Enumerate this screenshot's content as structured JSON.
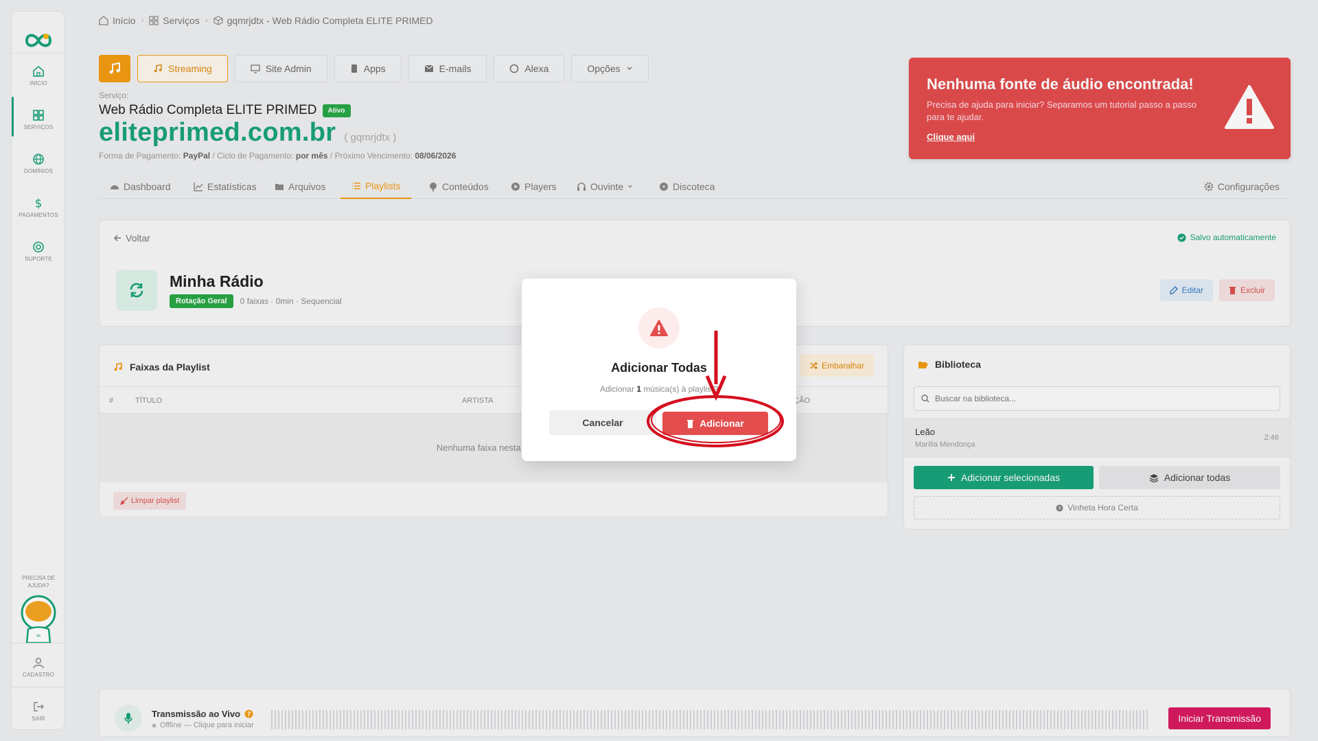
{
  "sidebar": {
    "items": [
      {
        "label": "INÍCIO",
        "icon": "home-icon"
      },
      {
        "label": "SERVIÇOS",
        "icon": "grid-icon"
      },
      {
        "label": "DOMÍNIOS",
        "icon": "globe-icon"
      },
      {
        "label": "PAGAMENTOS",
        "icon": "dollar-icon"
      },
      {
        "label": "SUPORTE",
        "icon": "lifebuoy-icon"
      }
    ],
    "help_line1": "PRECISA DE",
    "help_line2": "AJUDA?",
    "cadastro": "CADASTRO",
    "sair": "SAIR"
  },
  "breadcrumb": {
    "home": "Início",
    "services": "Serviços",
    "current": "gqmrjdtx - Web Rádio Completa ELITE PRIMED"
  },
  "top_tabs": [
    "Streaming",
    "Site Admin",
    "Apps",
    "E-mails",
    "Alexa",
    "Opções"
  ],
  "service": {
    "label": "Serviço:",
    "name": "Web Rádio Completa ELITE PRIMED",
    "status": "Ativo",
    "domain": "eliteprimed.com.br",
    "id": "( gqmrjdtx )",
    "payment_label": "Forma de Pagamento:",
    "payment_value": "PayPal",
    "cycle_label": "/ Ciclo de Pagamento:",
    "cycle_value": "por mês",
    "due_label": "/ Próximo Vencimento:",
    "due_value": "08/06/2026"
  },
  "alert": {
    "title": "Nenhuma fonte de áudio encontrada!",
    "text": "Precisa de ajuda para iniciar? Separamos um tutorial passo a passo para te ajudar.",
    "link": "Clique aqui",
    "color": "#e34d4d"
  },
  "nav_tabs": [
    "Dashboard",
    "Estatísticas",
    "Arquivos",
    "Playlists",
    "Conteúdos",
    "Players",
    "Ouvinte",
    "Discoteca",
    "Configurações"
  ],
  "playlist": {
    "back": "Voltar",
    "saved": "Salvo automaticamente",
    "title": "Minha Rádio",
    "badge": "Rotação Geral",
    "meta": "0 faixas · 0min · Sequencial",
    "edit": "Editar",
    "delete": "Excluir"
  },
  "tracks": {
    "title": "Faixas da Playlist",
    "shuffle": "Embaralhar",
    "col_num": "#",
    "col_title": "TÍTULO",
    "col_artist": "ARTISTA",
    "col_duration": "DURAÇÃO",
    "empty": "Nenhuma faixa nesta playlist",
    "clear": "Limpar playlist"
  },
  "library": {
    "title": "Biblioteca",
    "search_placeholder": "Buscar na biblioteca...",
    "song": "Leão",
    "artist": "Marília Mendonça",
    "duration": "2:46",
    "add_selected": "Adicionar selecionadas",
    "add_all": "Adicionar todas",
    "vinheta": "Vinheta Hora Certa"
  },
  "live": {
    "title": "Transmissão ao Vivo",
    "status": "Offline — Clique para iniciar",
    "button": "Iniciar Transmissão"
  },
  "modal": {
    "title": "Adicionar Todas",
    "text_prefix": "Adicionar",
    "count": "1",
    "text_suffix": "música(s) à playlist?",
    "cancel": "Cancelar",
    "confirm": "Adicionar"
  },
  "colors": {
    "accent": "#f39c12",
    "brand_green": "#1aa37a",
    "danger": "#e34d4d",
    "annotation": "#d40f1f"
  }
}
